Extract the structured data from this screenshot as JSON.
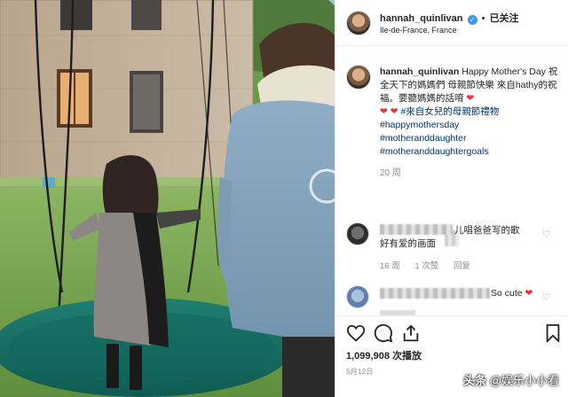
{
  "post": {
    "header": {
      "username": "hannah_quinlivan",
      "verified_badge": "✓",
      "separator": "•",
      "follow_state": "已关注",
      "location": "Ile-de-France, France"
    },
    "caption": {
      "username": "hannah_quinlivan",
      "text_line1": "Happy Mother's Day 祝全天下的媽媽們 母親節快樂 來自hathy的祝福。要聽媽媽的話唷",
      "text_line2": "#來自女兒的母親節禮物",
      "hashtags": [
        "#happymothersday",
        "#motheranddaughter",
        "#motheranddaughtergoals"
      ],
      "time": "20 周"
    },
    "comments": [
      {
        "text_visible": "儿唱爸爸写的歌",
        "text_line2": "好有爱的画面",
        "time": "16 周",
        "likes": "1 次赞",
        "reply": "回复"
      },
      {
        "text_visible": "So cute"
      }
    ],
    "stats": {
      "views": "1,099,908 次播放",
      "date": "5月12日"
    },
    "icons": [
      "heart-icon",
      "comment-icon",
      "share-icon",
      "bookmark-icon"
    ],
    "colors": {
      "accent_blue": "#3897f0",
      "hashtag": "#003569",
      "heart_red": "#ed2e39",
      "muted_text": "#8e8e8e"
    }
  },
  "watermark": {
    "logo": "头条",
    "text": "@娱乐小小看"
  }
}
